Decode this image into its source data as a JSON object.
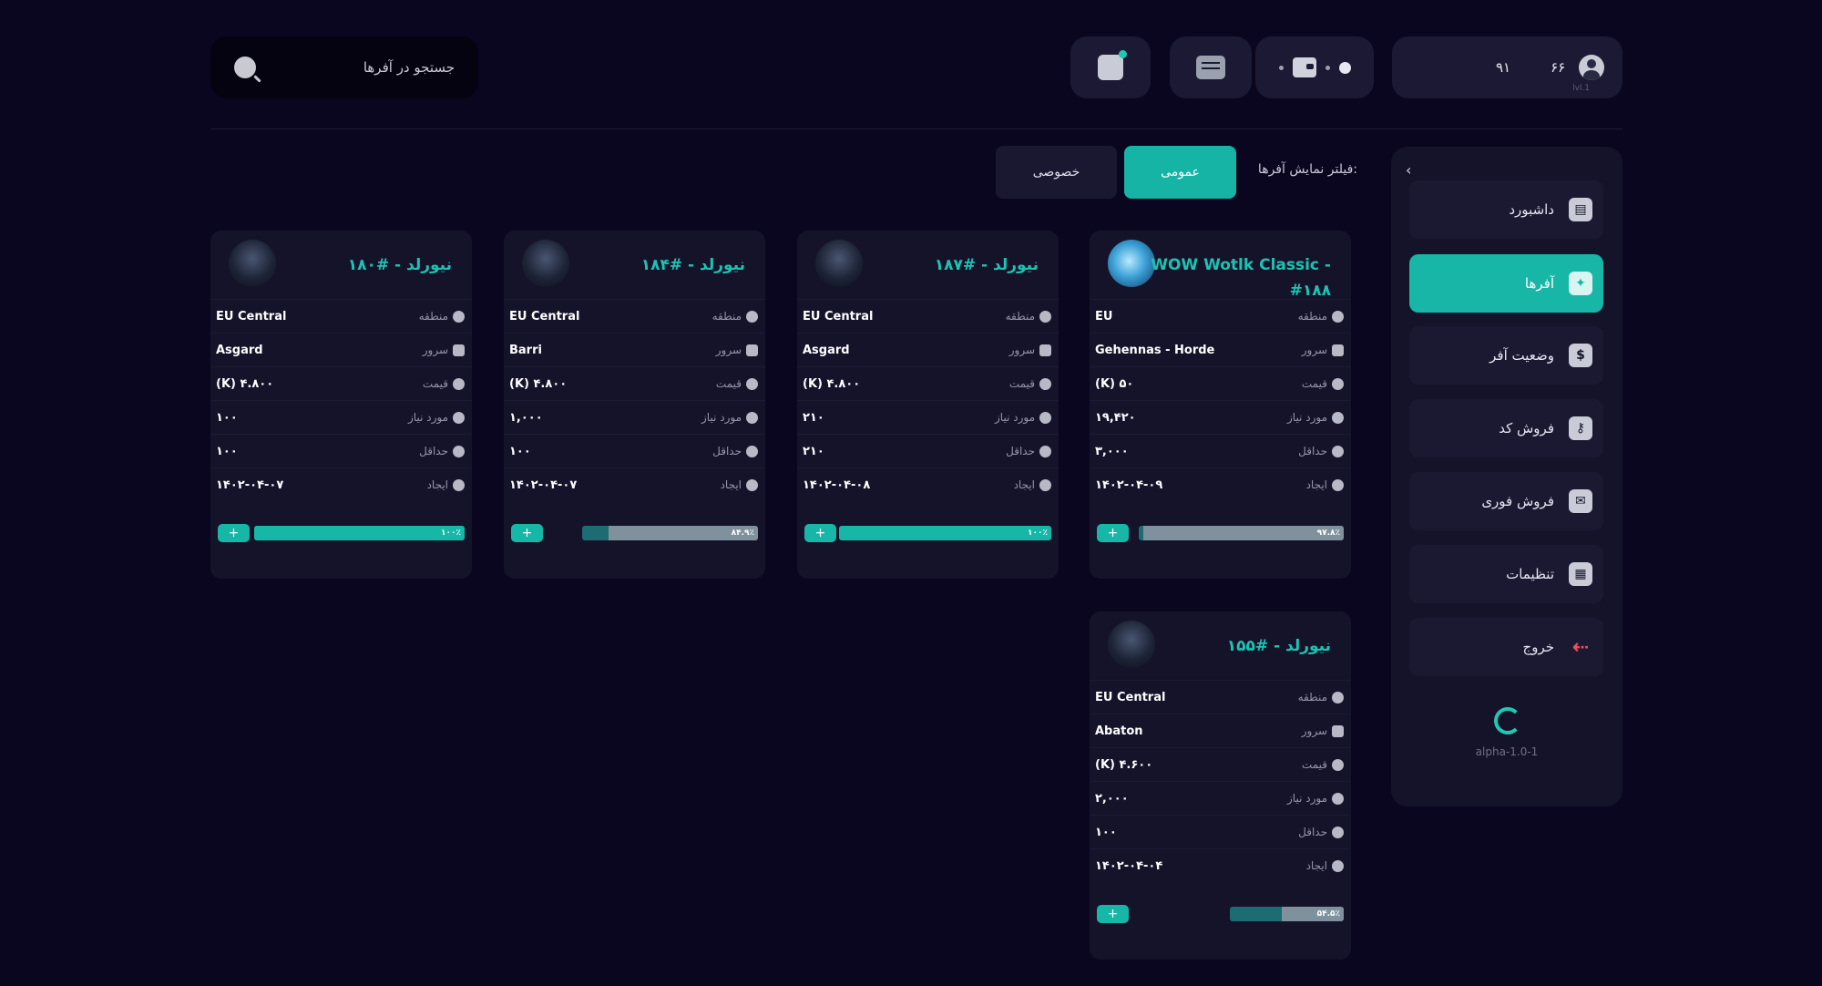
{
  "search": {
    "placeholder": "جستجو در آفرها"
  },
  "user": {
    "stat_a": "۶۶",
    "stat_b": "۹۱",
    "level": "lvl.1"
  },
  "filter": {
    "label": "فیلتر نمایش آفرها:",
    "tabs": [
      "عمومی",
      "خصوصی"
    ],
    "active": "عمومی"
  },
  "sidebar": {
    "items": [
      {
        "label": "داشبورد",
        "icon": "dashboard-icon"
      },
      {
        "label": "آفرها",
        "icon": "offers-icon",
        "active": true
      },
      {
        "label": "وضعیت آفر",
        "icon": "dollar-icon"
      },
      {
        "label": "فروش کد",
        "icon": "key-icon"
      },
      {
        "label": "فروش فوری",
        "icon": "instant-sale-icon"
      },
      {
        "label": "تنظیمات",
        "icon": "settings-icon"
      },
      {
        "label": "خروج",
        "icon": "exit-icon"
      }
    ],
    "version": "alpha-1.0-1"
  },
  "labels": {
    "region": "منطقه",
    "server": "سرور",
    "price": "قیمت",
    "required": "مورد نیاز",
    "min": "حداقل",
    "created": "ایجاد"
  },
  "cards": [
    {
      "title": "WOW Wotlk Classic - #۱۸۸",
      "region": "EU",
      "server": "Gehennas - Horde",
      "price": "(K) ۵۰",
      "required": "۱۹,۴۲۰",
      "min": "۳,۰۰۰",
      "created": "۱۴۰۲-۰۴-۰۹",
      "progress": 97.8,
      "progress_label": "۹۷.۸٪",
      "add": "+"
    },
    {
      "title": "نیورلد - #۱۸۷",
      "region": "EU Central",
      "server": "Asgard",
      "price": "(K) ۴.۸۰۰",
      "required": "۲۱۰",
      "min": "۲۱۰",
      "created": "۱۴۰۲-۰۴-۰۸",
      "progress": 100,
      "progress_label": "۱۰۰٪",
      "add": "+"
    },
    {
      "title": "نیورلد - #۱۸۴",
      "region": "EU Central",
      "server": "Barri",
      "price": "(K) ۴.۸۰۰",
      "required": "۱,۰۰۰",
      "min": "۱۰۰",
      "created": "۱۴۰۲-۰۴-۰۷",
      "progress": 84.9,
      "progress_label": "۸۴.۹٪",
      "add": "+"
    },
    {
      "title": "نیورلد - #۱۸۰",
      "region": "EU Central",
      "server": "Asgard",
      "price": "(K) ۴.۸۰۰",
      "required": "۱۰۰",
      "min": "۱۰۰",
      "created": "۱۴۰۲-۰۴-۰۷",
      "progress": 100,
      "progress_label": "۱۰۰٪",
      "add": "+"
    },
    {
      "title": "نیورلد - #۱۵۵",
      "region": "EU Central",
      "server": "Abaton",
      "price": "(K) ۴.۶۰۰",
      "required": "۲,۰۰۰",
      "min": "۱۰۰",
      "created": "۱۴۰۲-۰۴-۰۴",
      "progress": 54.5,
      "progress_label": "۵۴.۵٪",
      "add": "+"
    }
  ]
}
